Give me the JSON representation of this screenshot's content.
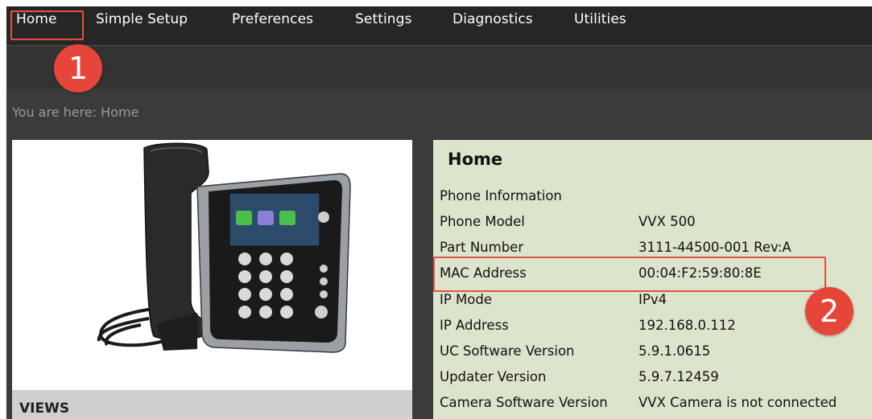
{
  "nav": {
    "items": [
      {
        "label": "Home"
      },
      {
        "label": "Simple Setup"
      },
      {
        "label": "Preferences"
      },
      {
        "label": "Settings"
      },
      {
        "label": "Diagnostics"
      },
      {
        "label": "Utilities"
      }
    ]
  },
  "breadcrumb": "You are here: Home",
  "views_label": "VIEWS",
  "info": {
    "title": "Home",
    "section_heading": "Phone Information",
    "rows": [
      {
        "label": "Phone Model",
        "value": "VVX 500"
      },
      {
        "label": "Part Number",
        "value": "3111-44500-001 Rev:A"
      },
      {
        "label": "MAC Address",
        "value": "00:04:F2:59:80:8E"
      },
      {
        "label": "IP Mode",
        "value": "IPv4"
      },
      {
        "label": "IP Address",
        "value": "192.168.0.112"
      },
      {
        "label": "UC Software Version",
        "value": "5.9.1.0615"
      },
      {
        "label": "Updater Version",
        "value": "5.9.7.12459"
      },
      {
        "label": "Camera Software Version",
        "value": "VVX Camera is not connected"
      }
    ]
  },
  "annotations": {
    "badge_1": "1",
    "badge_2": "2"
  },
  "colors": {
    "nav_bg": "#262626",
    "subbar_bg": "#333333",
    "body_bg": "#3b3b3b",
    "info_panel_bg": "#dde4cc",
    "annotation_red": "#e35146"
  }
}
